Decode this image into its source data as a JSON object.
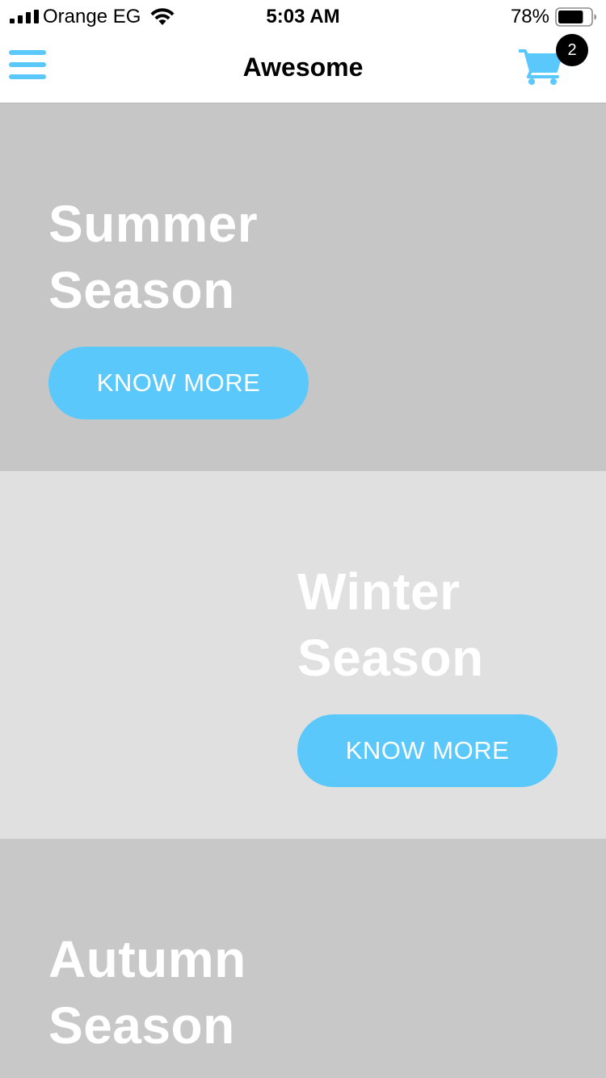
{
  "status_bar": {
    "carrier": "Orange EG",
    "time": "5:03 AM",
    "battery_percent": "78%",
    "battery_level": 0.78,
    "signal_bars": 4,
    "icons": [
      "signal-icon",
      "wifi-icon",
      "battery-icon"
    ]
  },
  "nav": {
    "title": "Awesome",
    "menu_icon": "hamburger-menu-icon",
    "cart_icon": "shopping-cart-icon",
    "cart_count": "2"
  },
  "colors": {
    "accent": "#5ac8fa",
    "summer_bg": "#c6c6c6",
    "winter_bg": "#e0e0e0",
    "autumn_bg": "#c8c8c8",
    "badge_bg": "#000000",
    "title_text": "#ffffff"
  },
  "seasons": [
    {
      "title_line1": "Summer",
      "title_line2": "Season",
      "button_label": "KNOW MORE"
    },
    {
      "title_line1": "Winter",
      "title_line2": "Season",
      "button_label": "KNOW MORE"
    },
    {
      "title_line1": "Autumn",
      "title_line2": "Season"
    }
  ]
}
